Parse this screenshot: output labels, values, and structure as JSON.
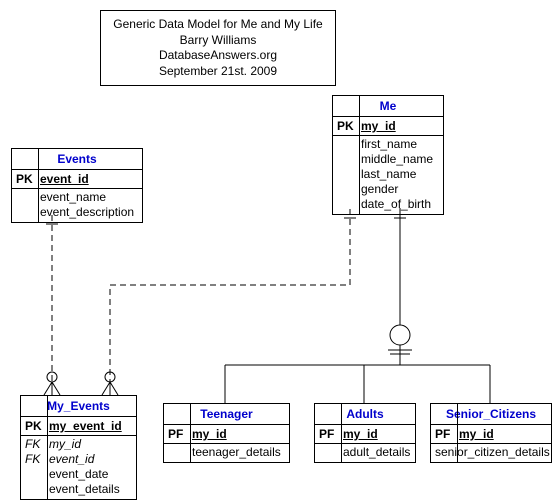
{
  "title": {
    "line1": "Generic Data Model for Me and My Life",
    "line2": "Barry Williams",
    "line3": "DatabaseAnswers.org",
    "line4": "September 21st. 2009"
  },
  "entities": {
    "me": {
      "name": "Me",
      "pk_key": "PK",
      "pk_attr": "my_id",
      "attrs": [
        "first_name",
        "middle_name",
        "last_name",
        "gender",
        "date_of_birth"
      ]
    },
    "events": {
      "name": "Events",
      "pk_key": "PK",
      "pk_attr": "event_id",
      "attrs": [
        "event_name",
        "event_description"
      ]
    },
    "my_events": {
      "name": "My_Events",
      "pk_key": "PK",
      "pk_attr": "my_event_id",
      "fk1_key": "FK",
      "fk1_attr": "my_id",
      "fk2_key": "FK",
      "fk2_attr": "event_id",
      "attrs": [
        "event_date",
        "event_details"
      ]
    },
    "teenager": {
      "name": "Teenager",
      "pf_key": "PF",
      "pf_attr": "my_id",
      "attrs": [
        "teenager_details"
      ]
    },
    "adults": {
      "name": "Adults",
      "pf_key": "PF",
      "pf_attr": "my_id",
      "attrs": [
        "adult_details"
      ]
    },
    "senior": {
      "name": "Senior_Citizens",
      "pf_key": "PF",
      "pf_attr": "my_id",
      "attrs": [
        "senior_citizen_details"
      ]
    }
  },
  "chart_data": {
    "type": "table",
    "title": "Generic Data Model for Me and My Life",
    "author": "Barry Williams",
    "source": "DatabaseAnswers.org",
    "date": "September 21st. 2009",
    "entities": [
      {
        "name": "Me",
        "pk": [
          "my_id"
        ],
        "attrs": [
          "first_name",
          "middle_name",
          "last_name",
          "gender",
          "date_of_birth"
        ]
      },
      {
        "name": "Events",
        "pk": [
          "event_id"
        ],
        "attrs": [
          "event_name",
          "event_description"
        ]
      },
      {
        "name": "My_Events",
        "pk": [
          "my_event_id"
        ],
        "fk": [
          "my_id",
          "event_id"
        ],
        "attrs": [
          "event_date",
          "event_details"
        ]
      },
      {
        "name": "Teenager",
        "pf": [
          "my_id"
        ],
        "attrs": [
          "teenager_details"
        ]
      },
      {
        "name": "Adults",
        "pf": [
          "my_id"
        ],
        "attrs": [
          "adult_details"
        ]
      },
      {
        "name": "Senior_Citizens",
        "pf": [
          "my_id"
        ],
        "attrs": [
          "senior_citizen_details"
        ]
      }
    ],
    "relationships": [
      {
        "from": "Events",
        "to": "My_Events",
        "type": "one-to-many",
        "style": "dashed"
      },
      {
        "from": "Me",
        "to": "My_Events",
        "type": "one-to-many",
        "style": "dashed"
      },
      {
        "from": "Me",
        "to": [
          "Teenager",
          "Adults",
          "Senior_Citizens"
        ],
        "type": "subtype"
      }
    ]
  }
}
